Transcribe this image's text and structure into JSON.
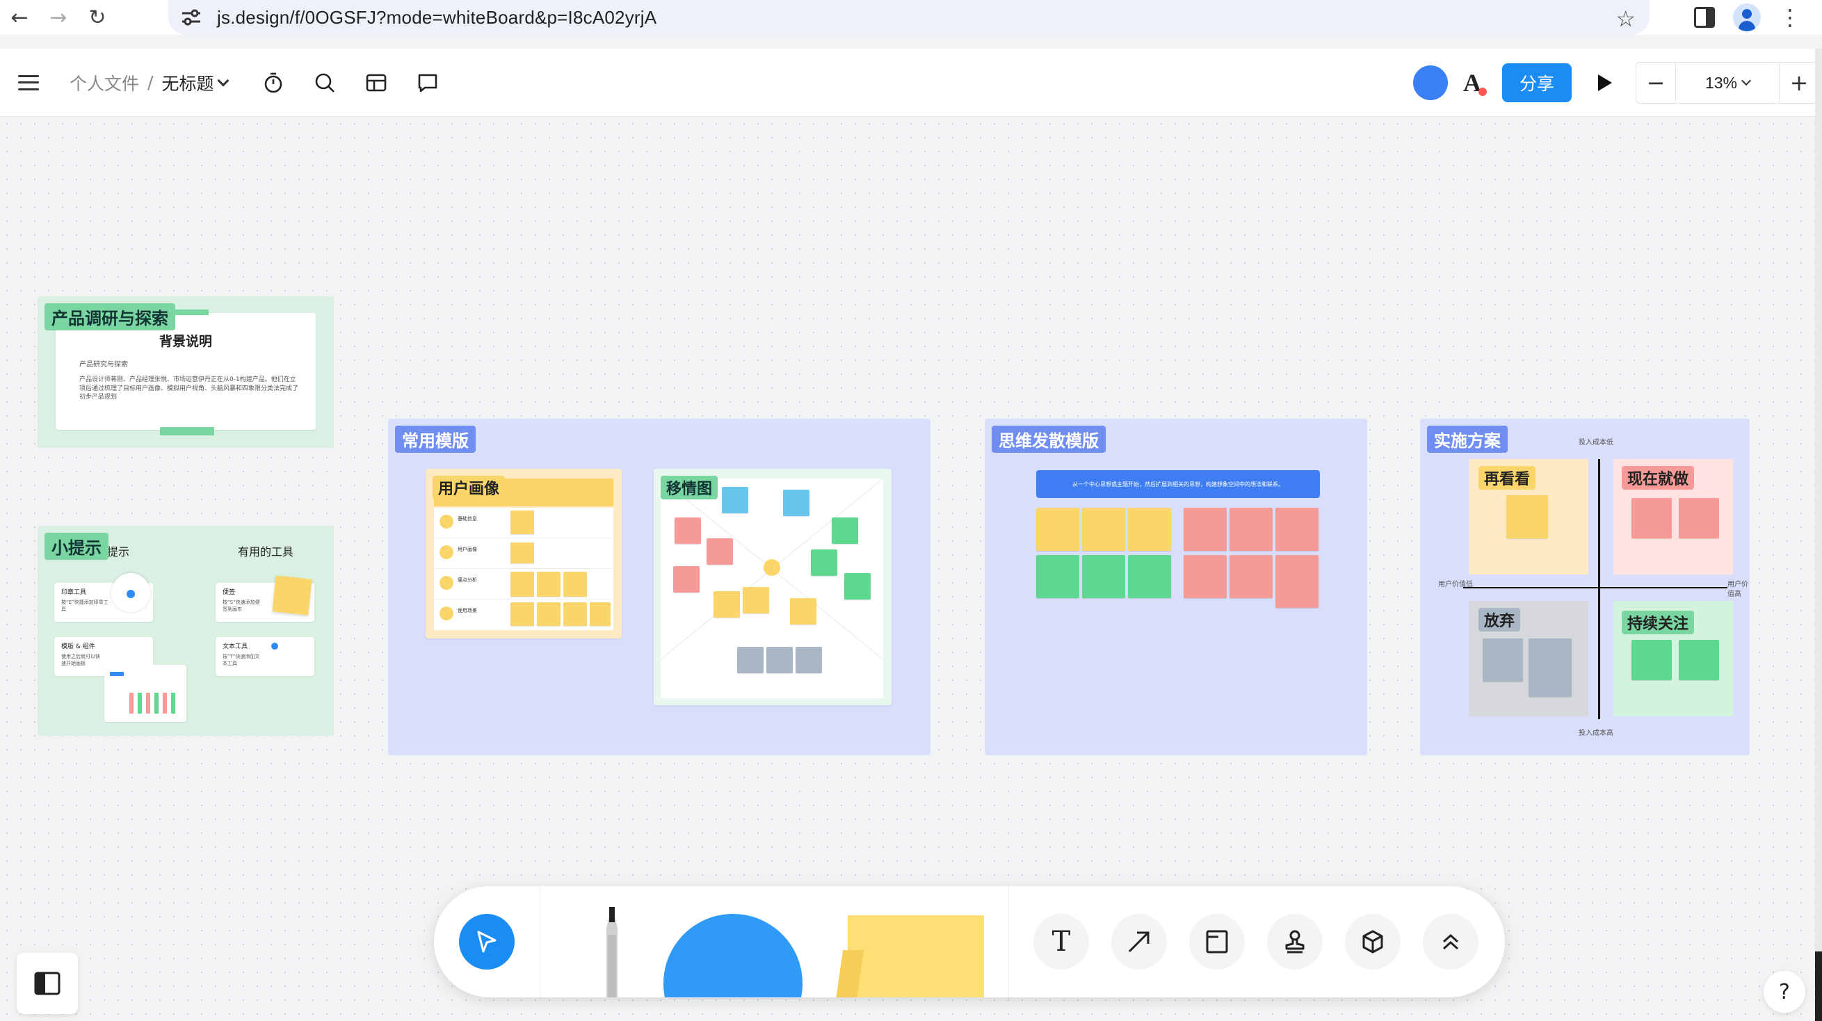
{
  "browser": {
    "url": "js.design/f/0OGSFJ?mode=whiteBoard&p=I8cA02yrjA"
  },
  "header": {
    "breadcrumb_parent": "个人文件",
    "breadcrumb_sep": "/",
    "file_title": "无标题",
    "share_label": "分享",
    "zoom_level": "13%",
    "zoom_minus": "−",
    "zoom_plus": "+",
    "accent_color": "#1c8cf5"
  },
  "frames": {
    "research": {
      "label": "产品调研与探索",
      "card_title": "背景说明",
      "card_subtitle": "产品研究与探索",
      "card_text": "产品设计师蒋刚、产品经理张悦、市场运营伊丹正在从0-1构建产品。他们在立项后通过梳理了目标用户画像、模拟用户视角、头脑风暴和四象限分类法完成了初步产品规划"
    },
    "tips": {
      "label": "小提示",
      "col1_title": "提示",
      "col2_title": "有用的工具",
      "item1_title": "印章工具",
      "item1_text": "按“E”快捷添加印章工具",
      "item2_title": "模版 & 组件",
      "item2_text": "使用之后就可以快速开始画板",
      "item3_title": "便签",
      "item3_text": "按“S”快速添加便签到画布",
      "item4_title": "文本工具",
      "item4_text": "按“T”快速添加文本工具"
    },
    "templates": {
      "label": "常用模版",
      "persona_label": "用户画像",
      "persona_rows": [
        "基础信息",
        "用户画像",
        "痛点分析",
        "使用场景"
      ],
      "empathy_label": "移情图"
    },
    "mindmap": {
      "label": "思维发散模版",
      "banner": "从一个中心思想或主题开始，然后扩展到相关的思想，构建想象空间中的想法和联系。"
    },
    "plan": {
      "label": "实施方案",
      "axis_top": "投入成本低",
      "axis_bottom": "投入成本高",
      "axis_left": "用户价值低",
      "axis_right": "用户价值高",
      "q1": "再看看",
      "q2": "现在就做",
      "q3": "放弃",
      "q4": "持续关注"
    }
  },
  "toolbar": {
    "text_tool": "T",
    "colors": {
      "select": "#1c8cf5",
      "shape": "#2f9bf6",
      "sticky": "#fddf76"
    }
  },
  "help_label": "?"
}
